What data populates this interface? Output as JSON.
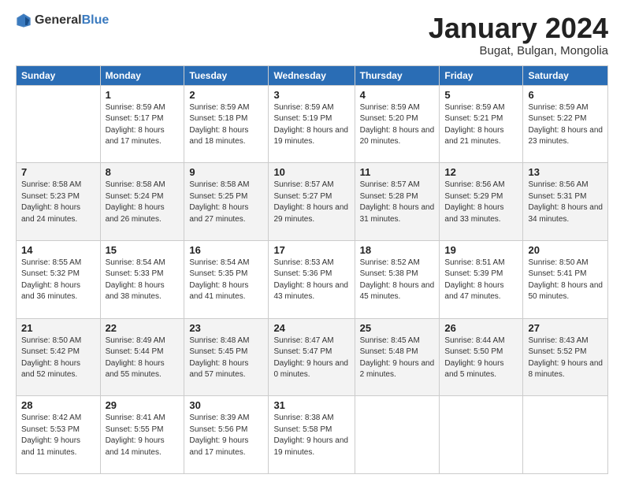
{
  "logo": {
    "general": "General",
    "blue": "Blue"
  },
  "header": {
    "month": "January 2024",
    "location": "Bugat, Bulgan, Mongolia"
  },
  "weekdays": [
    "Sunday",
    "Monday",
    "Tuesday",
    "Wednesday",
    "Thursday",
    "Friday",
    "Saturday"
  ],
  "weeks": [
    [
      {
        "day": "",
        "sunrise": "",
        "sunset": "",
        "daylight": ""
      },
      {
        "day": "1",
        "sunrise": "Sunrise: 8:59 AM",
        "sunset": "Sunset: 5:17 PM",
        "daylight": "Daylight: 8 hours and 17 minutes."
      },
      {
        "day": "2",
        "sunrise": "Sunrise: 8:59 AM",
        "sunset": "Sunset: 5:18 PM",
        "daylight": "Daylight: 8 hours and 18 minutes."
      },
      {
        "day": "3",
        "sunrise": "Sunrise: 8:59 AM",
        "sunset": "Sunset: 5:19 PM",
        "daylight": "Daylight: 8 hours and 19 minutes."
      },
      {
        "day": "4",
        "sunrise": "Sunrise: 8:59 AM",
        "sunset": "Sunset: 5:20 PM",
        "daylight": "Daylight: 8 hours and 20 minutes."
      },
      {
        "day": "5",
        "sunrise": "Sunrise: 8:59 AM",
        "sunset": "Sunset: 5:21 PM",
        "daylight": "Daylight: 8 hours and 21 minutes."
      },
      {
        "day": "6",
        "sunrise": "Sunrise: 8:59 AM",
        "sunset": "Sunset: 5:22 PM",
        "daylight": "Daylight: 8 hours and 23 minutes."
      }
    ],
    [
      {
        "day": "7",
        "sunrise": "Sunrise: 8:58 AM",
        "sunset": "Sunset: 5:23 PM",
        "daylight": "Daylight: 8 hours and 24 minutes."
      },
      {
        "day": "8",
        "sunrise": "Sunrise: 8:58 AM",
        "sunset": "Sunset: 5:24 PM",
        "daylight": "Daylight: 8 hours and 26 minutes."
      },
      {
        "day": "9",
        "sunrise": "Sunrise: 8:58 AM",
        "sunset": "Sunset: 5:25 PM",
        "daylight": "Daylight: 8 hours and 27 minutes."
      },
      {
        "day": "10",
        "sunrise": "Sunrise: 8:57 AM",
        "sunset": "Sunset: 5:27 PM",
        "daylight": "Daylight: 8 hours and 29 minutes."
      },
      {
        "day": "11",
        "sunrise": "Sunrise: 8:57 AM",
        "sunset": "Sunset: 5:28 PM",
        "daylight": "Daylight: 8 hours and 31 minutes."
      },
      {
        "day": "12",
        "sunrise": "Sunrise: 8:56 AM",
        "sunset": "Sunset: 5:29 PM",
        "daylight": "Daylight: 8 hours and 33 minutes."
      },
      {
        "day": "13",
        "sunrise": "Sunrise: 8:56 AM",
        "sunset": "Sunset: 5:31 PM",
        "daylight": "Daylight: 8 hours and 34 minutes."
      }
    ],
    [
      {
        "day": "14",
        "sunrise": "Sunrise: 8:55 AM",
        "sunset": "Sunset: 5:32 PM",
        "daylight": "Daylight: 8 hours and 36 minutes."
      },
      {
        "day": "15",
        "sunrise": "Sunrise: 8:54 AM",
        "sunset": "Sunset: 5:33 PM",
        "daylight": "Daylight: 8 hours and 38 minutes."
      },
      {
        "day": "16",
        "sunrise": "Sunrise: 8:54 AM",
        "sunset": "Sunset: 5:35 PM",
        "daylight": "Daylight: 8 hours and 41 minutes."
      },
      {
        "day": "17",
        "sunrise": "Sunrise: 8:53 AM",
        "sunset": "Sunset: 5:36 PM",
        "daylight": "Daylight: 8 hours and 43 minutes."
      },
      {
        "day": "18",
        "sunrise": "Sunrise: 8:52 AM",
        "sunset": "Sunset: 5:38 PM",
        "daylight": "Daylight: 8 hours and 45 minutes."
      },
      {
        "day": "19",
        "sunrise": "Sunrise: 8:51 AM",
        "sunset": "Sunset: 5:39 PM",
        "daylight": "Daylight: 8 hours and 47 minutes."
      },
      {
        "day": "20",
        "sunrise": "Sunrise: 8:50 AM",
        "sunset": "Sunset: 5:41 PM",
        "daylight": "Daylight: 8 hours and 50 minutes."
      }
    ],
    [
      {
        "day": "21",
        "sunrise": "Sunrise: 8:50 AM",
        "sunset": "Sunset: 5:42 PM",
        "daylight": "Daylight: 8 hours and 52 minutes."
      },
      {
        "day": "22",
        "sunrise": "Sunrise: 8:49 AM",
        "sunset": "Sunset: 5:44 PM",
        "daylight": "Daylight: 8 hours and 55 minutes."
      },
      {
        "day": "23",
        "sunrise": "Sunrise: 8:48 AM",
        "sunset": "Sunset: 5:45 PM",
        "daylight": "Daylight: 8 hours and 57 minutes."
      },
      {
        "day": "24",
        "sunrise": "Sunrise: 8:47 AM",
        "sunset": "Sunset: 5:47 PM",
        "daylight": "Daylight: 9 hours and 0 minutes."
      },
      {
        "day": "25",
        "sunrise": "Sunrise: 8:45 AM",
        "sunset": "Sunset: 5:48 PM",
        "daylight": "Daylight: 9 hours and 2 minutes."
      },
      {
        "day": "26",
        "sunrise": "Sunrise: 8:44 AM",
        "sunset": "Sunset: 5:50 PM",
        "daylight": "Daylight: 9 hours and 5 minutes."
      },
      {
        "day": "27",
        "sunrise": "Sunrise: 8:43 AM",
        "sunset": "Sunset: 5:52 PM",
        "daylight": "Daylight: 9 hours and 8 minutes."
      }
    ],
    [
      {
        "day": "28",
        "sunrise": "Sunrise: 8:42 AM",
        "sunset": "Sunset: 5:53 PM",
        "daylight": "Daylight: 9 hours and 11 minutes."
      },
      {
        "day": "29",
        "sunrise": "Sunrise: 8:41 AM",
        "sunset": "Sunset: 5:55 PM",
        "daylight": "Daylight: 9 hours and 14 minutes."
      },
      {
        "day": "30",
        "sunrise": "Sunrise: 8:39 AM",
        "sunset": "Sunset: 5:56 PM",
        "daylight": "Daylight: 9 hours and 17 minutes."
      },
      {
        "day": "31",
        "sunrise": "Sunrise: 8:38 AM",
        "sunset": "Sunset: 5:58 PM",
        "daylight": "Daylight: 9 hours and 19 minutes."
      },
      {
        "day": "",
        "sunrise": "",
        "sunset": "",
        "daylight": ""
      },
      {
        "day": "",
        "sunrise": "",
        "sunset": "",
        "daylight": ""
      },
      {
        "day": "",
        "sunrise": "",
        "sunset": "",
        "daylight": ""
      }
    ]
  ]
}
